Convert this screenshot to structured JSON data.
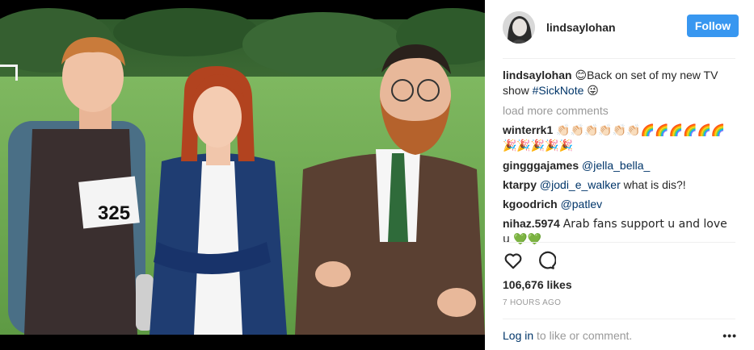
{
  "post": {
    "username": "lindsaylohan",
    "follow_label": "Follow"
  },
  "photo": {
    "bib_number": "325"
  },
  "caption": {
    "user": "lindsaylohan",
    "emoji_start": "😊",
    "text": "Back on set of my new TV show ",
    "hashtag": "#SickNote",
    "emoji_end": "😜"
  },
  "load_more": "load more comments",
  "comments": [
    {
      "user": "winterrk1",
      "mention": "",
      "text": "👏🏻👏🏻👏🏻👏🏻👏🏻👏🏻🌈🌈🌈🌈🌈🌈🎉🎉🎉🎉🎉"
    },
    {
      "user": "gingggajames",
      "mention": "@jella_bella_",
      "text": ""
    },
    {
      "user": "ktarpy",
      "mention": "@jodi_e_walker",
      "text": " what is dis?!"
    },
    {
      "user": "kgoodrich",
      "mention": "@patlev",
      "text": ""
    },
    {
      "user": "nihaz.5974",
      "mention": "",
      "text": "Arab fans support u and love u 💚💚"
    }
  ],
  "likes": "106,676 likes",
  "time": "7 HOURS AGO",
  "login": {
    "link": "Log in",
    "text": " to like or comment.",
    "more": "•••"
  },
  "icons": {
    "like": "heart-icon",
    "comment": "comment-bubble-icon",
    "more": "more-options-icon"
  },
  "colors": {
    "follow_button": "#3897f0",
    "link": "#003569",
    "muted": "#999999"
  }
}
